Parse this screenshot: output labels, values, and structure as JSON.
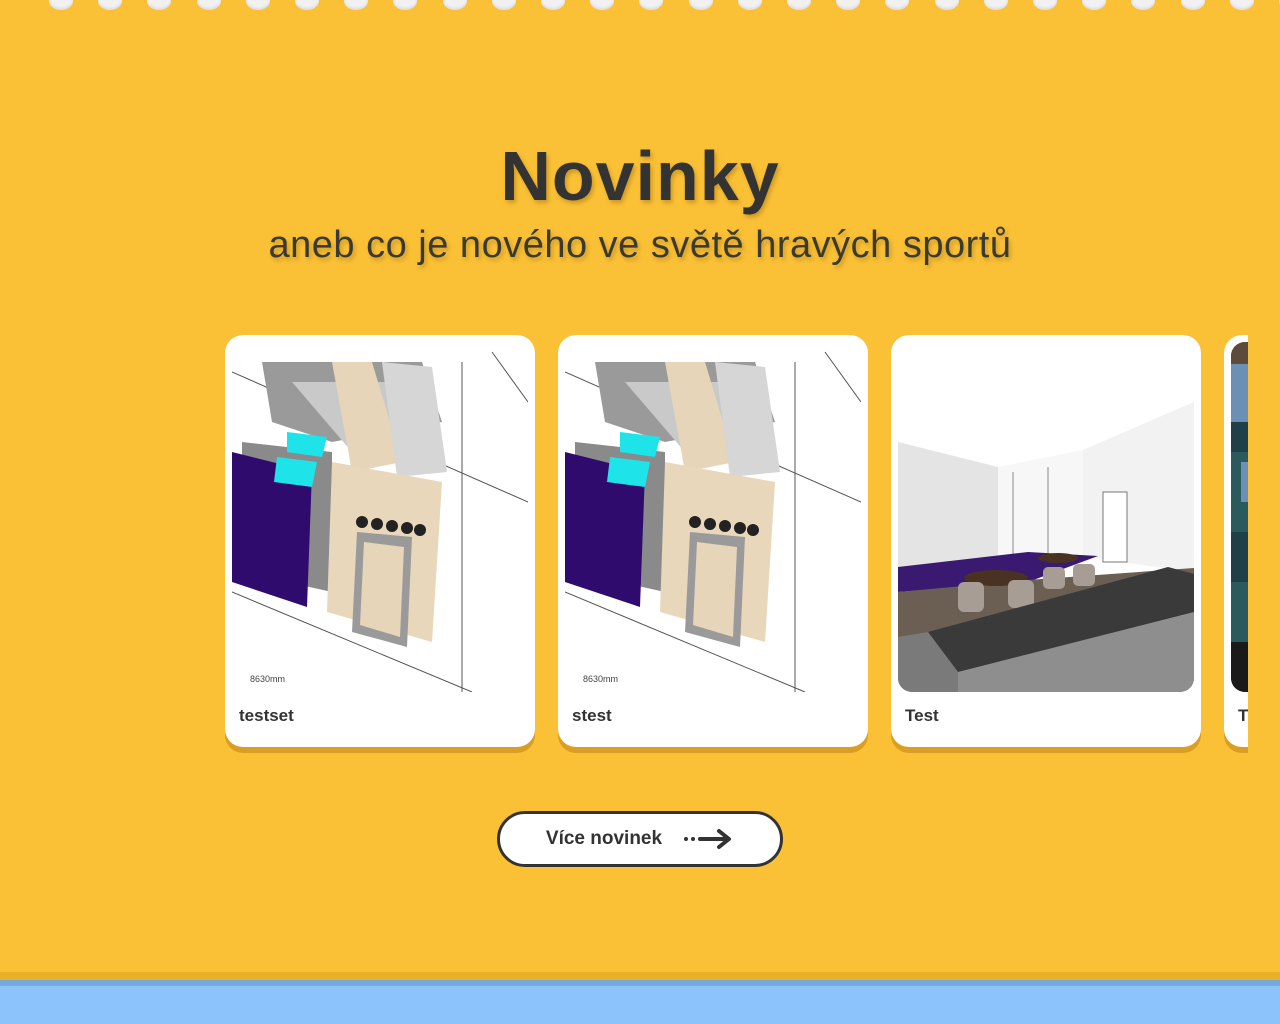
{
  "section": {
    "title": "Novinky",
    "subtitle": "aneb co je nového ve světě hravých sportů"
  },
  "news": [
    {
      "label": "testset",
      "image": "floorplan-render"
    },
    {
      "label": "stest",
      "image": "floorplan-render"
    },
    {
      "label": "Test",
      "image": "interior-render"
    },
    {
      "label": "T",
      "image": "carpet-photo"
    }
  ],
  "more_button": {
    "label": "Více novinek",
    "icon": "dotted-arrow-right-icon"
  },
  "colors": {
    "background": "#fbc136",
    "card": "#ffffff",
    "text": "#333333",
    "footer": "#8cc3fb"
  }
}
